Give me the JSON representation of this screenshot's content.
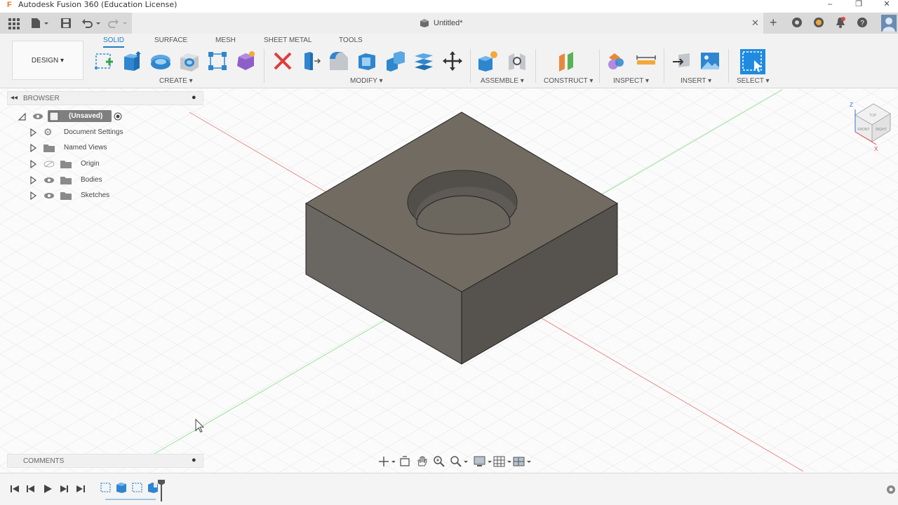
{
  "window": {
    "app_title": "Autodesk Fusion 360 (Education License)",
    "logo_letter": "F",
    "document_tab": "Untitled*"
  },
  "ribbon": {
    "workspace_button": "DESIGN ▾",
    "tabs": [
      "SOLID",
      "SURFACE",
      "MESH",
      "SHEET METAL",
      "TOOLS"
    ],
    "groups": {
      "create": "CREATE ▾",
      "modify": "MODIFY ▾",
      "assemble": "ASSEMBLE ▾",
      "construct": "CONSTRUCT ▾",
      "inspect": "INSPECT ▾",
      "insert": "INSERT ▾",
      "select": "SELECT ▾"
    }
  },
  "browser": {
    "header": "BROWSER",
    "root": "(Unsaved)",
    "items": [
      "Document Settings",
      "Named Views",
      "Origin",
      "Bodies",
      "Sketches"
    ]
  },
  "comments": {
    "header": "COMMENTS"
  },
  "viewcube": {
    "axis_z": "Z",
    "axis_x": "X",
    "face_front": "FRONT",
    "face_right": "RIGHT",
    "face_top": "TOP"
  },
  "colors": {
    "accent": "#1f7dc2",
    "body_top": "#706a61",
    "body_left": "#6a6762",
    "body_right": "#56534e",
    "grid_line": "#e6e6e6",
    "x_axis": "#e26060",
    "y_axis": "#7fd87f"
  }
}
